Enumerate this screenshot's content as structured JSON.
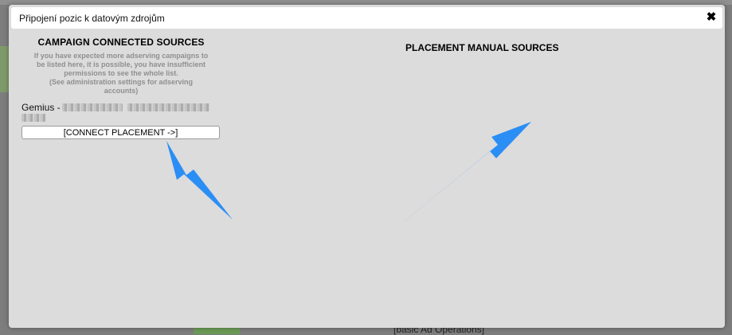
{
  "dialog": {
    "title": "Připojení pozic k datovým zdrojům",
    "close_icon": "close-icon"
  },
  "left": {
    "heading": "CAMPAIGN CONNECTED SOURCES",
    "note_lines": [
      "If you have expected more adserving campaigns to",
      "be listed here, it is possible, you have insufficient",
      "permissions to see the whole list.",
      "(See administration settings for adserving",
      "accounts)"
    ],
    "source_prefix": "Gemius -",
    "connect_label": "[CONNECT PLACEMENT ->]"
  },
  "right": {
    "heading": "PLACEMENT MANUAL SOURCES"
  },
  "background": {
    "footer_text": "[basic Ad Operations]"
  },
  "colors": {
    "modal_bg": "#dcdcdc",
    "header_bg": "#ffffff",
    "annotation_arrow": "#2b8ef5"
  }
}
